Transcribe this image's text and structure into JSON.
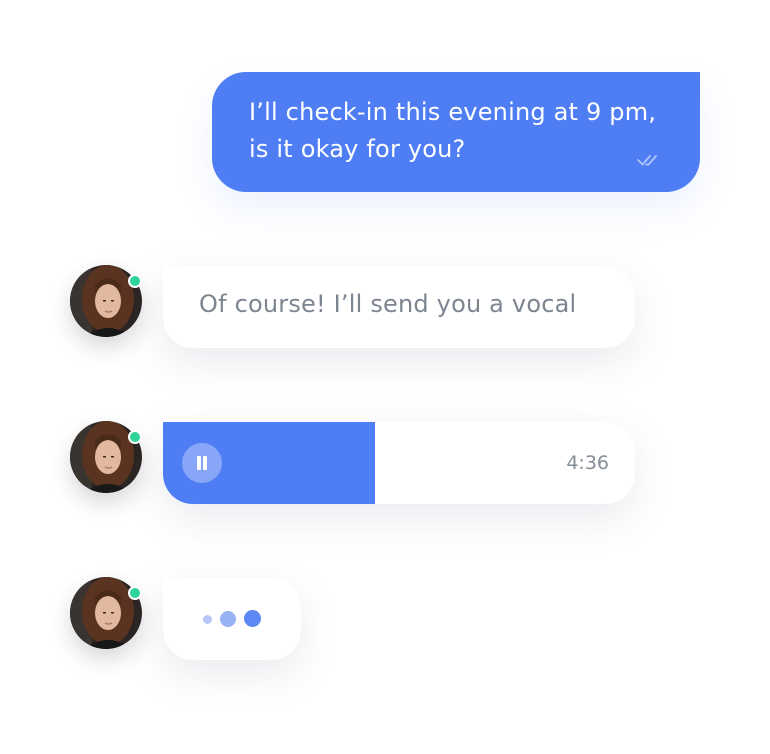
{
  "colors": {
    "accent": "#4f7df3",
    "online_status": "#2fd49a",
    "incoming_text": "#7d8591",
    "background": "#ffffff"
  },
  "messages": {
    "outgoing": {
      "text": "I’ll check-in this evening at 9 pm,\nis it okay for you?",
      "status_icon": "double-check-icon"
    },
    "incoming_text": {
      "text": "Of course! I’ll send you a vocal",
      "sender_online": true
    },
    "incoming_voice": {
      "duration": "4:36",
      "progress": 0.45,
      "control_icon": "pause-icon",
      "sender_online": true
    },
    "typing": {
      "sender_online": true,
      "dots": 3
    }
  }
}
